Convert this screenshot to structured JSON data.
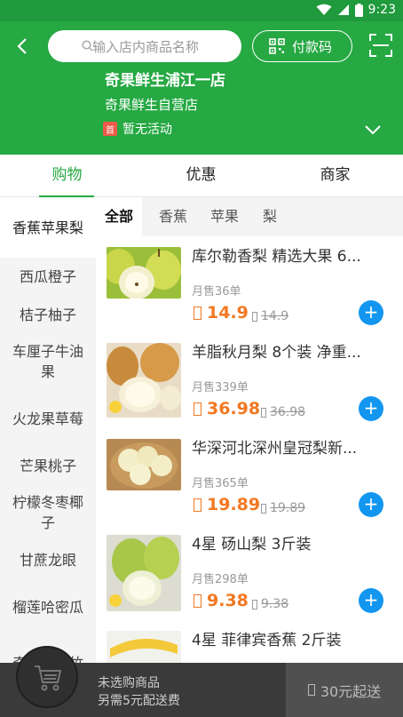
{
  "status_bar": {
    "time": "9:23"
  },
  "header": {
    "search_placeholder": "输入店内商品名称",
    "pay_code_label": "付款码",
    "store_name": "奇果鲜生浦江一店",
    "store_subtitle": "奇果鲜生自营店",
    "promo_badge": "首",
    "promo_text": "暂无活动"
  },
  "tabs": [
    {
      "label": "购物",
      "active": true
    },
    {
      "label": "优惠",
      "active": false
    },
    {
      "label": "商家",
      "active": false
    }
  ],
  "categories": [
    "香蕉苹果梨",
    "西瓜橙子",
    "桔子柚子",
    "车厘子牛油果",
    "火龙果草莓",
    "芒果桃子",
    "柠檬冬枣椰子",
    "甘蔗龙眼",
    "榴莲哈密瓜",
    "奇异果山竹"
  ],
  "subtabs": [
    {
      "label": "全部",
      "active": true
    },
    {
      "label": "香蕉",
      "active": false
    },
    {
      "label": "苹果",
      "active": false
    },
    {
      "label": "梨",
      "active": false
    }
  ],
  "products": [
    {
      "name": "库尔勒香梨 精选大果 6...",
      "sold": "月售36单",
      "price": "14.9",
      "old_price": "14.9"
    },
    {
      "name": "羊脂秋月梨 8个装 净重...",
      "sold": "月售339单",
      "price": "36.98",
      "old_price": "36.98"
    },
    {
      "name": "华深河北深州皇冠梨新...",
      "sold": "月售365单",
      "price": "19.89",
      "old_price": "19.89"
    },
    {
      "name": "4星 砀山梨 3斤装",
      "sold": "月售298单",
      "price": "9.38",
      "old_price": "9.38"
    },
    {
      "name": "4星 菲律宾香蕉 2斤装",
      "sold": "",
      "price": "",
      "old_price": ""
    }
  ],
  "bottom_bar": {
    "line1": "未选购商品",
    "line2": "另需5元配送费",
    "min_order": "30元起送"
  },
  "colors": {
    "brand_green": "#26a843",
    "price_orange": "#f27820",
    "add_blue": "#1296f0"
  }
}
